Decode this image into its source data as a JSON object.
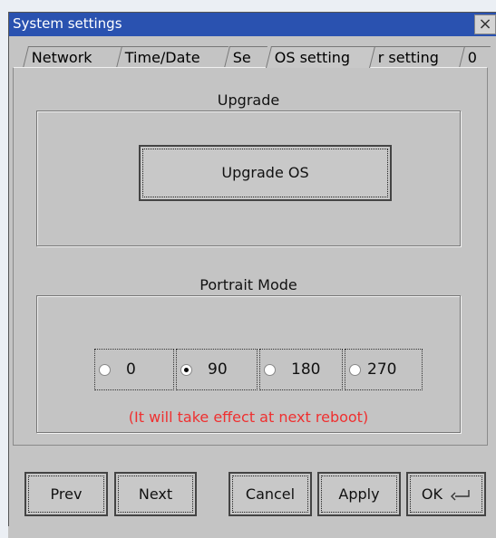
{
  "window": {
    "title": "System settings",
    "close_glyph": "×"
  },
  "tabs": [
    {
      "label": "Network",
      "active": false
    },
    {
      "label": "Time/Date",
      "active": false
    },
    {
      "label": "Se",
      "active": false
    },
    {
      "label": "OS setting",
      "active": true
    },
    {
      "label": "r setting",
      "active": false
    },
    {
      "label": "0",
      "active": false
    }
  ],
  "upgrade": {
    "group_label": "Upgrade",
    "button_label": "Upgrade OS"
  },
  "portrait": {
    "group_label": "Portrait Mode",
    "options": [
      {
        "label": "0",
        "selected": false
      },
      {
        "label": "90",
        "selected": true
      },
      {
        "label": "180",
        "selected": false
      },
      {
        "label": "270",
        "selected": false
      }
    ],
    "note": "(It will take effect at next reboot)",
    "note_color": "#ef3030"
  },
  "footer": {
    "prev": "Prev",
    "next": "Next",
    "cancel": "Cancel",
    "apply": "Apply",
    "ok": "OK",
    "ok_icon": "enter-icon"
  },
  "colors": {
    "titlebar": "#2a52b0",
    "window_bg": "#c4c4c4"
  }
}
